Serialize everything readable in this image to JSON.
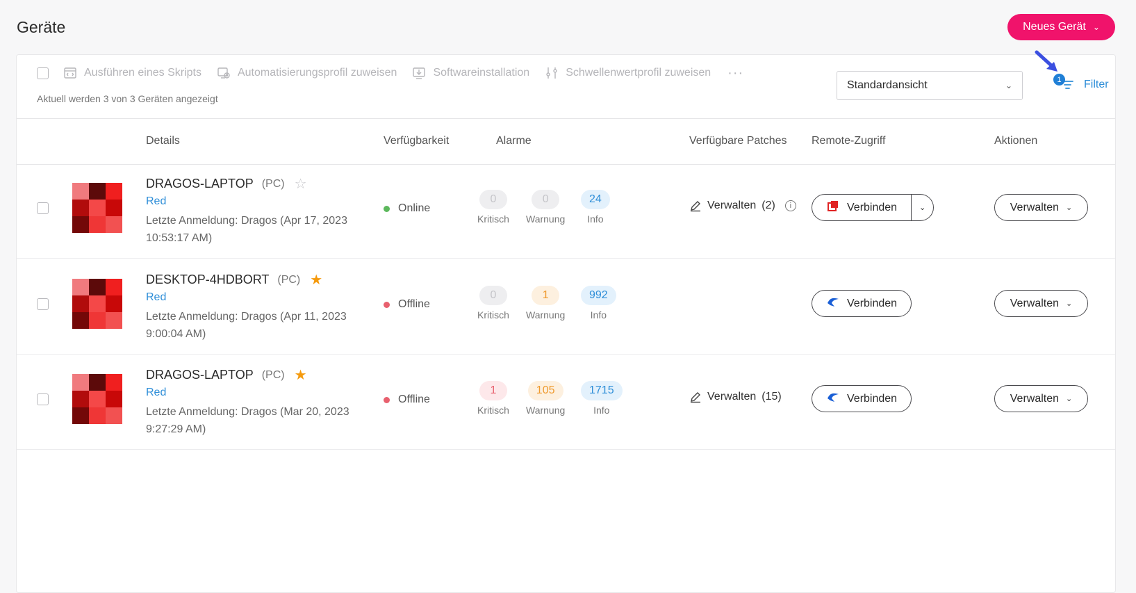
{
  "page": {
    "title": "Geräte"
  },
  "header": {
    "new_device_label": "Neues Gerät"
  },
  "toolbar": {
    "actions": [
      {
        "label": "Ausführen eines Skripts",
        "icon": "script-icon"
      },
      {
        "label": "Automatisierungsprofil zuweisen",
        "icon": "automation-profile-icon"
      },
      {
        "label": "Softwareinstallation",
        "icon": "download-icon"
      },
      {
        "label": "Schwellenwertprofil zuweisen",
        "icon": "sliders-icon"
      }
    ],
    "more_label": "···",
    "count_text": "Aktuell werden 3 von 3 Geräten angezeigt",
    "view_select_value": "Standardansicht",
    "filter_label": "Filter",
    "filter_badge": "1"
  },
  "table": {
    "headers": {
      "details": "Details",
      "availability": "Verfügbarkeit",
      "alarms": "Alarme",
      "patches": "Verfügbare Patches",
      "remote": "Remote-Zugriff",
      "actions": "Aktionen"
    },
    "alarm_labels": {
      "critical": "Kritisch",
      "warning": "Warnung",
      "info": "Info"
    },
    "rows": [
      {
        "name": "DRAGOS-LAPTOP",
        "type": "(PC)",
        "favorite": false,
        "org": "Red",
        "login_line1": "Letzte Anmeldung: Dragos (Apr 17, 2023",
        "login_line2": "10:53:17 AM)",
        "status": "Online",
        "status_color": "#5cb85c",
        "critical": "0",
        "warning": "0",
        "info": "24",
        "patch_label": "Verwalten",
        "patch_count": "(2)",
        "connect_label": "Verbinden",
        "manage_label": "Verwalten"
      },
      {
        "name": "DESKTOP-4HDBORT",
        "type": "(PC)",
        "favorite": true,
        "org": "Red",
        "login_line1": "Letzte Anmeldung: Dragos (Apr 11, 2023",
        "login_line2": "9:00:04 AM)",
        "status": "Offline",
        "status_color": "#e8606e",
        "critical": "0",
        "warning": "1",
        "info": "992",
        "patch_label": "",
        "patch_count": "",
        "connect_label": "Verbinden",
        "manage_label": "Verwalten"
      },
      {
        "name": "DRAGOS-LAPTOP",
        "type": "(PC)",
        "favorite": true,
        "org": "Red",
        "login_line1": "Letzte Anmeldung: Dragos (Mar 20, 2023",
        "login_line2": "9:27:29 AM)",
        "status": "Offline",
        "status_color": "#e8606e",
        "critical": "1",
        "warning": "105",
        "info": "1715",
        "patch_label": "Verwalten",
        "patch_count": "(15)",
        "connect_label": "Verbinden",
        "manage_label": "Verwalten"
      }
    ]
  },
  "colors": {
    "accent": "#f0136b",
    "link": "#2e8ed8",
    "star": "#f59a0c"
  }
}
